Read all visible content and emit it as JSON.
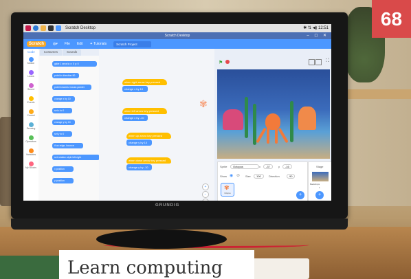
{
  "badge": "68",
  "caption": "Learn computing",
  "monitor": {
    "brand": "GRUNDIG"
  },
  "taskbar": {
    "title": "Scratch Desktop",
    "clock": "12:51"
  },
  "window": {
    "title": "Scratch Desktop",
    "controls": "– ◻ ✕"
  },
  "menubar": {
    "logo": "Scratch",
    "items": [
      "File",
      "Edit",
      "Tutorials"
    ],
    "project": "Scratch Project"
  },
  "tabs": [
    "Code",
    "Costumes",
    "Sounds"
  ],
  "categories": [
    {
      "label": "Motion",
      "color": "#4c97ff"
    },
    {
      "label": "Looks",
      "color": "#9966ff"
    },
    {
      "label": "Sound",
      "color": "#cf63cf"
    },
    {
      "label": "Events",
      "color": "#ffbf00"
    },
    {
      "label": "Control",
      "color": "#ffab19"
    },
    {
      "label": "Sensing",
      "color": "#5cb1d6"
    },
    {
      "label": "Operators",
      "color": "#59c059"
    },
    {
      "label": "Variables",
      "color": "#ff8c1a"
    },
    {
      "label": "My Blocks",
      "color": "#ff6680"
    }
  ],
  "palette_blocks": [
    "glide 1 secs to x: 0 y: 0",
    "point in direction 90",
    "point towards mouse-pointer",
    "change x by 10",
    "set x to 0",
    "change y by 10",
    "set y to 0",
    "if on edge, bounce",
    "set rotation style left-right",
    "x position",
    "y position"
  ],
  "scripts": [
    {
      "hat": "when right arrow key pressed",
      "body": "change x by 10"
    },
    {
      "hat": "when left arrow key pressed",
      "body": "change x by -10"
    },
    {
      "hat": "when up arrow key pressed",
      "body": "change y by 10"
    },
    {
      "hat": "when down arrow key pressed",
      "body": "change y by -10"
    }
  ],
  "sprite_info": {
    "sprite_label": "Sprite",
    "sprite_name": "Octopus",
    "x_label": "x",
    "x": "-37",
    "y_label": "y",
    "y": "-16",
    "show_label": "Show",
    "size_label": "Size",
    "size": "100",
    "direction_label": "Direction",
    "direction": "90",
    "thumb_label": "Octopus"
  },
  "stage_panel": {
    "label": "Stage",
    "backdrops_label": "Backdrops",
    "backdrops": "1"
  }
}
